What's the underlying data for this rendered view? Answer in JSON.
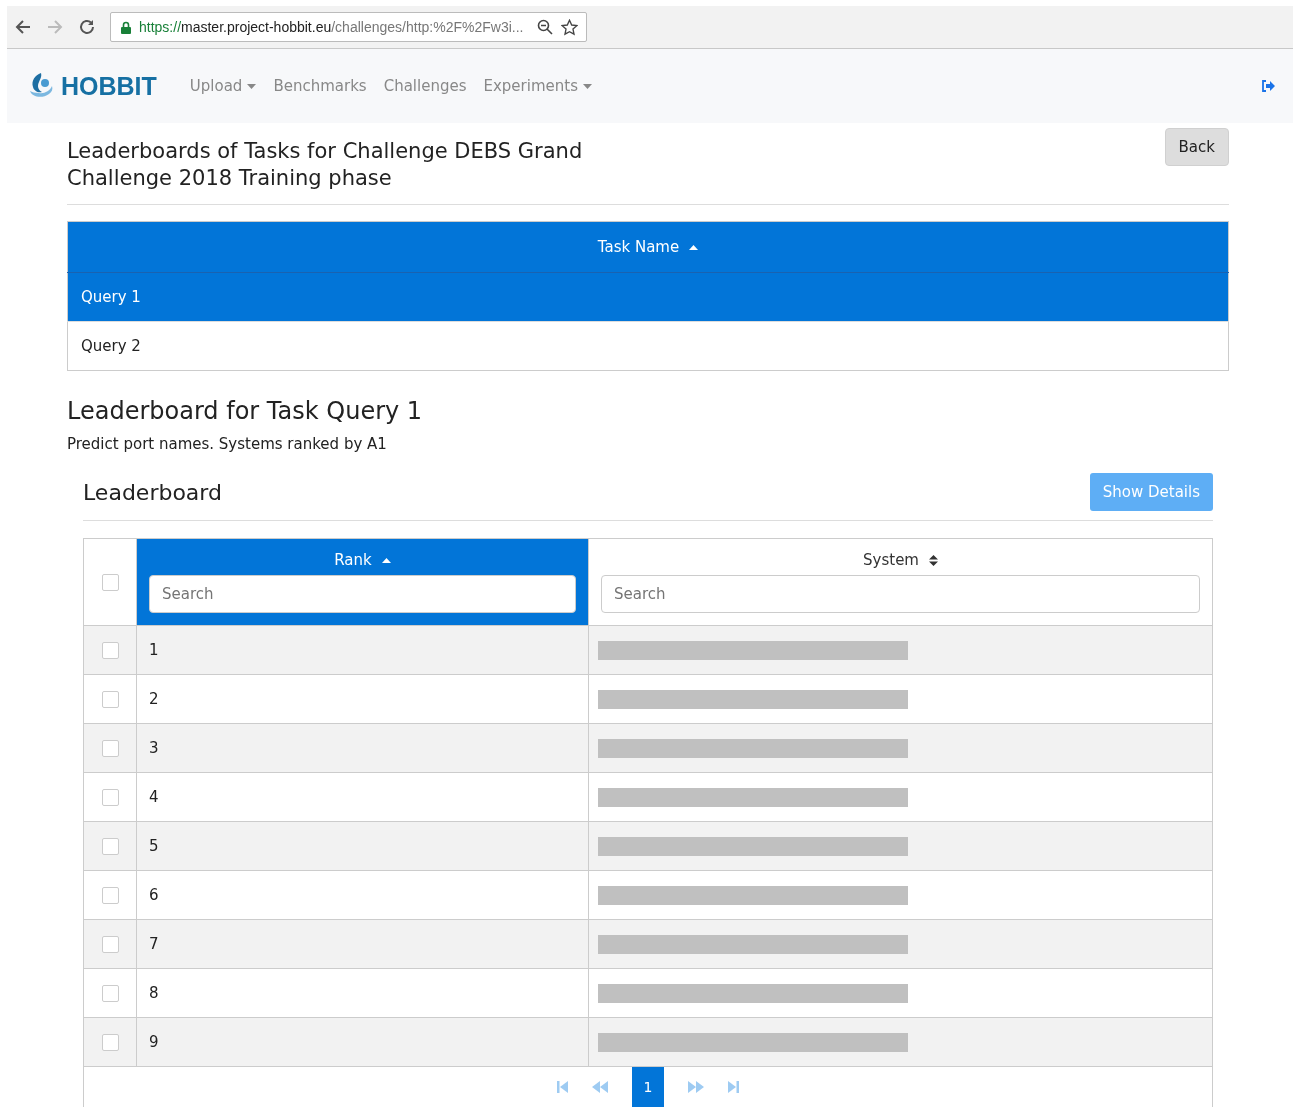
{
  "browser": {
    "url_scheme": "https://",
    "url_host": "master.project-hobbit.eu",
    "url_path": "/challenges/http:%2F%2Fw3i..."
  },
  "navbar": {
    "brand": "HOBBIT",
    "items": [
      {
        "label": "Upload",
        "dropdown": true
      },
      {
        "label": "Benchmarks",
        "dropdown": false
      },
      {
        "label": "Challenges",
        "dropdown": false
      },
      {
        "label": "Experiments",
        "dropdown": true
      }
    ]
  },
  "page": {
    "title": "Leaderboards of Tasks for Challenge DEBS Grand Challenge 2018 Training phase",
    "back_button": "Back"
  },
  "tasks_table": {
    "column": "Task Name",
    "sorted_asc": true,
    "rows": [
      {
        "label": "Query 1",
        "selected": true
      },
      {
        "label": "Query 2",
        "selected": false
      }
    ]
  },
  "leaderboard_section": {
    "heading": "Leaderboard for Task Query 1",
    "description": "Predict port names. Systems ranked by A1"
  },
  "leaderboard": {
    "title": "Leaderboard",
    "details_button": "Show Details",
    "columns": [
      {
        "label": "Rank",
        "sorted_asc": true,
        "selected": true,
        "placeholder": "Search"
      },
      {
        "label": "System",
        "sorted_asc": false,
        "selected": false,
        "placeholder": "Search"
      }
    ],
    "header_checked": false,
    "rows": [
      {
        "rank": "1",
        "checked": false,
        "system_redacted": true
      },
      {
        "rank": "2",
        "checked": false,
        "system_redacted": true
      },
      {
        "rank": "3",
        "checked": false,
        "system_redacted": true
      },
      {
        "rank": "4",
        "checked": false,
        "system_redacted": true
      },
      {
        "rank": "5",
        "checked": false,
        "system_redacted": true
      },
      {
        "rank": "6",
        "checked": false,
        "system_redacted": true
      },
      {
        "rank": "7",
        "checked": false,
        "system_redacted": true
      },
      {
        "rank": "8",
        "checked": false,
        "system_redacted": true
      },
      {
        "rank": "9",
        "checked": false,
        "system_redacted": true
      }
    ],
    "pagination": {
      "pages": [
        {
          "label": "1",
          "selected": true
        }
      ]
    }
  }
}
